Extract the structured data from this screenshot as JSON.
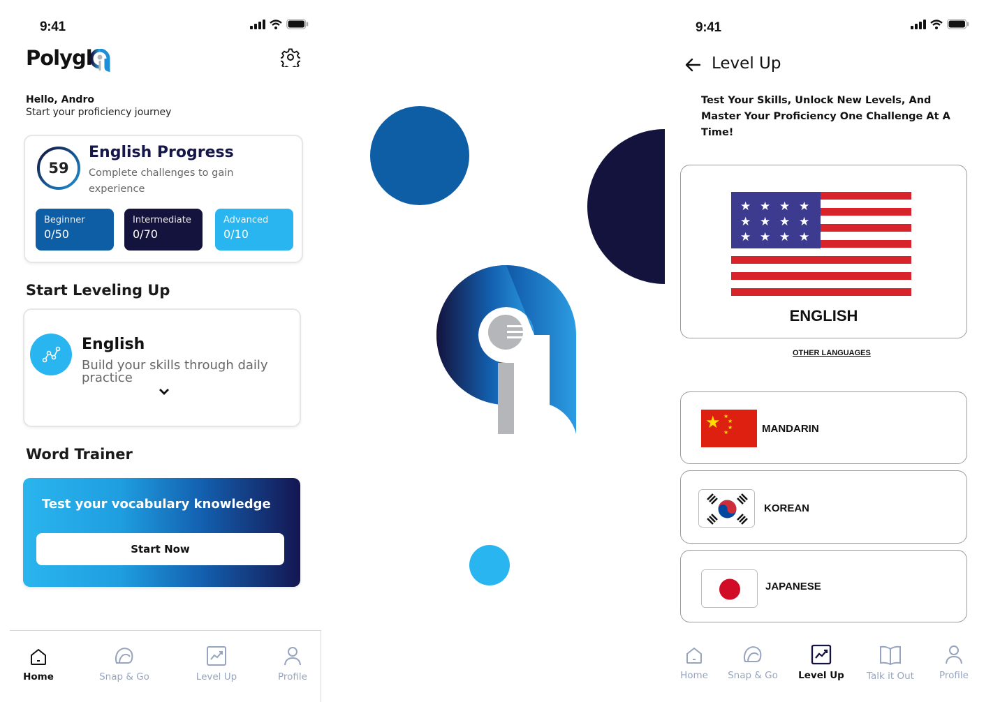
{
  "left_screen": {
    "status": {
      "time": "9:41"
    },
    "header": {
      "logo": "Polygl"
    },
    "greeting": {
      "name": "Hello, Andro",
      "subtitle": "Start your proficiency journey"
    },
    "progress": {
      "score": "59",
      "score_fraction": 0.59,
      "title": "English Progress",
      "subtitle": "Complete challenges to gain experience",
      "levels": [
        {
          "name": "Beginner",
          "value": "0/50",
          "color": "#0d5ea5"
        },
        {
          "name": "Intermediate",
          "value": "0/70",
          "color": "#14133d"
        },
        {
          "name": "Advanced",
          "value": "0/10",
          "color": "#29b6f0"
        }
      ]
    },
    "leveling": {
      "heading": "Start Leveling Up",
      "course_title": "English",
      "course_subtitle": "Build your skills through daily practice"
    },
    "trainer": {
      "heading": "Word Trainer",
      "card_title": "Test your vocabulary knowledge",
      "button": "Start Now"
    },
    "tabs": [
      {
        "label": "Home",
        "icon": "home-icon",
        "active": true
      },
      {
        "label": "Snap & Go",
        "icon": "chat-bubble-icon",
        "active": false
      },
      {
        "label": "Level Up",
        "icon": "chart-icon",
        "active": false
      },
      {
        "label": "Profile",
        "icon": "person-icon",
        "active": false
      }
    ]
  },
  "center_brand": {
    "colors": {
      "blue": "#0d5ea5",
      "navy": "#14133d",
      "cyan": "#29b6f0",
      "gray": "#b4b6b9"
    }
  },
  "right_screen": {
    "status": {
      "time": "9:41"
    },
    "title": "Level Up",
    "subtitle": "Test Your Skills, Unlock New Levels, And Master Your Proficiency One Challenge At A Time!",
    "featured": {
      "language": "ENGLISH",
      "flag": "us-flag"
    },
    "other_languages_link": "OTHER LANGUAGES",
    "languages": [
      {
        "name": "MANDARIN",
        "flag": "china-flag"
      },
      {
        "name": "KOREAN",
        "flag": "korea-flag"
      },
      {
        "name": "JAPANESE",
        "flag": "japan-flag"
      }
    ],
    "tabs": [
      {
        "label": "Home",
        "icon": "home-icon",
        "active": false
      },
      {
        "label": "Snap & Go",
        "icon": "chat-bubble-icon",
        "active": false
      },
      {
        "label": "Level Up",
        "icon": "chart-icon",
        "active": true
      },
      {
        "label": "Talk it Out",
        "icon": "book-icon",
        "active": false
      },
      {
        "label": "Profile",
        "icon": "person-icon",
        "active": false
      }
    ]
  }
}
